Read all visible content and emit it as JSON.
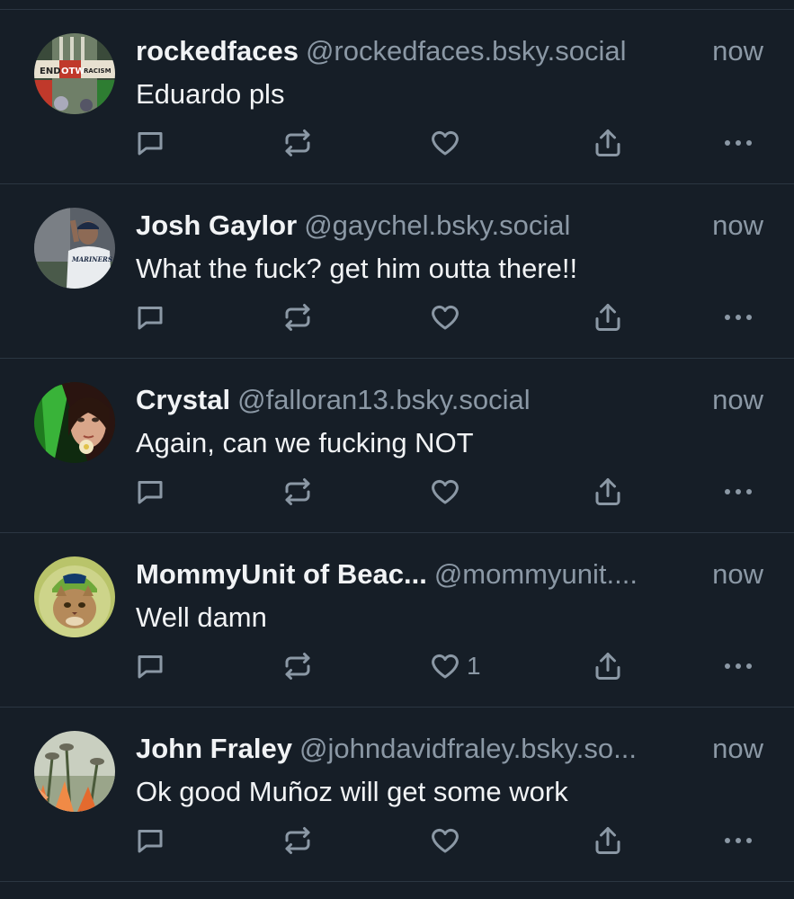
{
  "feed": {
    "posts": [
      {
        "display_name": "rockedfaces",
        "handle": "@rockedfaces.bsky.social",
        "time": "now",
        "text": "Eduardo pls",
        "like_count": "",
        "avatar_icon": "end-otw-racism-avatar",
        "avatar_text": [
          "END",
          "OTW",
          "RACISM"
        ]
      },
      {
        "display_name": "Josh Gaylor",
        "handle": "@gaychel.bsky.social",
        "time": "now",
        "text": "What the fuck? get him outta there!!",
        "like_count": "",
        "avatar_icon": "baseball-player-avatar",
        "avatar_text": [
          "MARINERS"
        ]
      },
      {
        "display_name": "Crystal",
        "handle": "@falloran13.bsky.social",
        "time": "now",
        "text": "Again, can we fucking NOT",
        "like_count": "",
        "avatar_icon": "woman-portrait-avatar",
        "avatar_text": []
      },
      {
        "display_name": "MommyUnit of Beac...",
        "handle": "@mommyunit....",
        "time": "now",
        "text": "Well damn",
        "like_count": "1",
        "avatar_icon": "cat-in-helmet-avatar",
        "avatar_text": []
      },
      {
        "display_name": "John Fraley",
        "handle": "@johndavidfraley.bsky.so...",
        "time": "now",
        "text": "Ok good Muñoz will get some work",
        "like_count": "",
        "avatar_icon": "flowers-avatar",
        "avatar_text": []
      }
    ]
  },
  "colors": {
    "background": "#161e27",
    "divider": "#2b3642",
    "text_primary": "#f1f3f5",
    "text_secondary": "#8b98a5"
  },
  "icons": [
    "reply-icon",
    "repost-icon",
    "like-icon",
    "share-icon",
    "more-icon"
  ]
}
